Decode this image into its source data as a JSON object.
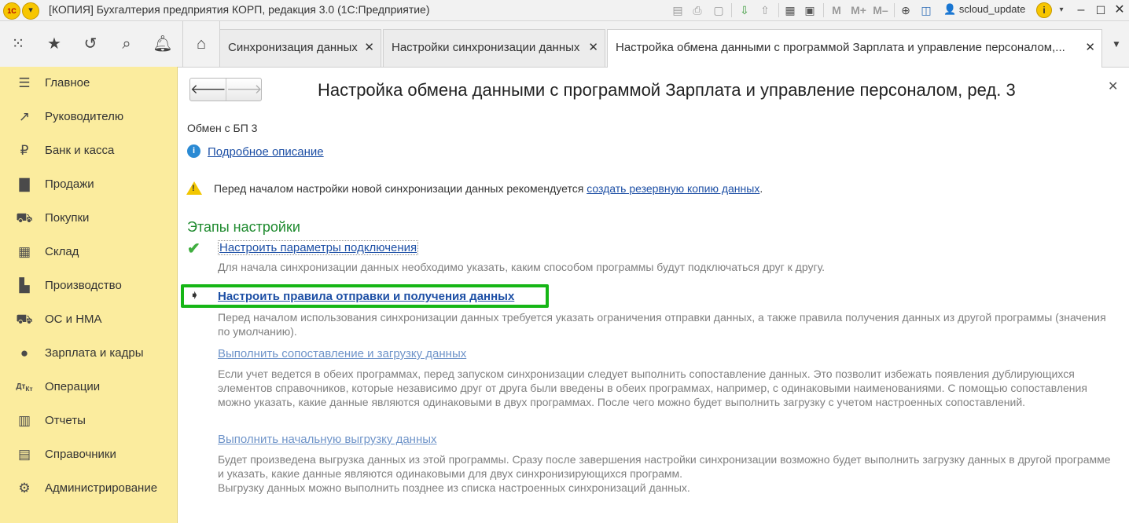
{
  "window": {
    "title": "[КОПИЯ] Бухгалтерия предприятия КОРП, редакция 3.0  (1С:Предприятие)",
    "logo_text": "1С",
    "user": "scloud_update"
  },
  "tabs": [
    {
      "label": "Синхронизация данных"
    },
    {
      "label": "Настройки синхронизации данных"
    },
    {
      "label": "Настройка обмена данными с программой Зарплата и управление персоналом,..."
    }
  ],
  "sidebar": {
    "items": [
      {
        "label": "Главное",
        "icon": "menu-lines-icon"
      },
      {
        "label": "Руководителю",
        "icon": "trend-icon"
      },
      {
        "label": "Банк и касса",
        "icon": "ruble-icon"
      },
      {
        "label": "Продажи",
        "icon": "bag-icon"
      },
      {
        "label": "Покупки",
        "icon": "cart-icon"
      },
      {
        "label": "Склад",
        "icon": "warehouse-icon"
      },
      {
        "label": "Производство",
        "icon": "factory-icon"
      },
      {
        "label": "ОС и НМА",
        "icon": "truck-icon"
      },
      {
        "label": "Зарплата и кадры",
        "icon": "person-icon"
      },
      {
        "label": "Операции",
        "icon": "dt-kt-icon"
      },
      {
        "label": "Отчеты",
        "icon": "chart-icon"
      },
      {
        "label": "Справочники",
        "icon": "book-icon"
      },
      {
        "label": "Администрирование",
        "icon": "gear-icon"
      }
    ]
  },
  "form": {
    "title": "Настройка обмена данными с программой Зарплата и управление персоналом, ред. 3",
    "exchange_name": "Обмен с БП 3",
    "detail_link": "Подробное описание",
    "warning_prefix": "Перед началом настройки новой синхронизации данных рекомендуется ",
    "warning_link": "создать резервную копию данных",
    "warning_suffix": ".",
    "section_title": "Этапы настройки",
    "steps": [
      {
        "link": "Настроить параметры подключения",
        "status": "done",
        "description": "Для начала синхронизации данных необходимо указать, каким способом программы будут подключаться друг к другу."
      },
      {
        "link": "Настроить правила отправки и получения данных",
        "status": "current",
        "description": "Перед началом использования синхронизации данных требуется указать ограничения отправки данных, а также правила получения данных из другой программы (значения по умолчанию)."
      },
      {
        "link": "Выполнить сопоставление и загрузку данных",
        "status": "pending",
        "description": "Если учет ведется в обеих программах, перед запуском синхронизации следует выполнить сопоставление данных. Это позволит избежать появления дублирующихся элементов справочников, которые независимо друг от друга были введены в обеих программах, например, с одинаковыми наименованиями. С помощью сопоставления можно указать, какие данные являются одинаковыми в двух программах. После чего можно будет выполнить загрузку с учетом настроенных сопоставлений."
      },
      {
        "link": "Выполнить начальную выгрузку данных",
        "status": "pending",
        "description": "Будет произведена выгрузка данных из этой программы. Сразу после завершения настройки синхронизации возможно будет выполнить загрузку данных в другой программе и указать, какие данные являются одинаковыми для двух синхронизирующихся программ.",
        "description2": "Выгрузку данных можно выполнить позднее из списка настроенных синхронизаций данных."
      }
    ]
  },
  "colors": {
    "sidebar_bg": "#fbec9e",
    "section_green": "#1e8a2e",
    "highlight_green": "#16b616",
    "link_blue": "#1d4fa5"
  }
}
